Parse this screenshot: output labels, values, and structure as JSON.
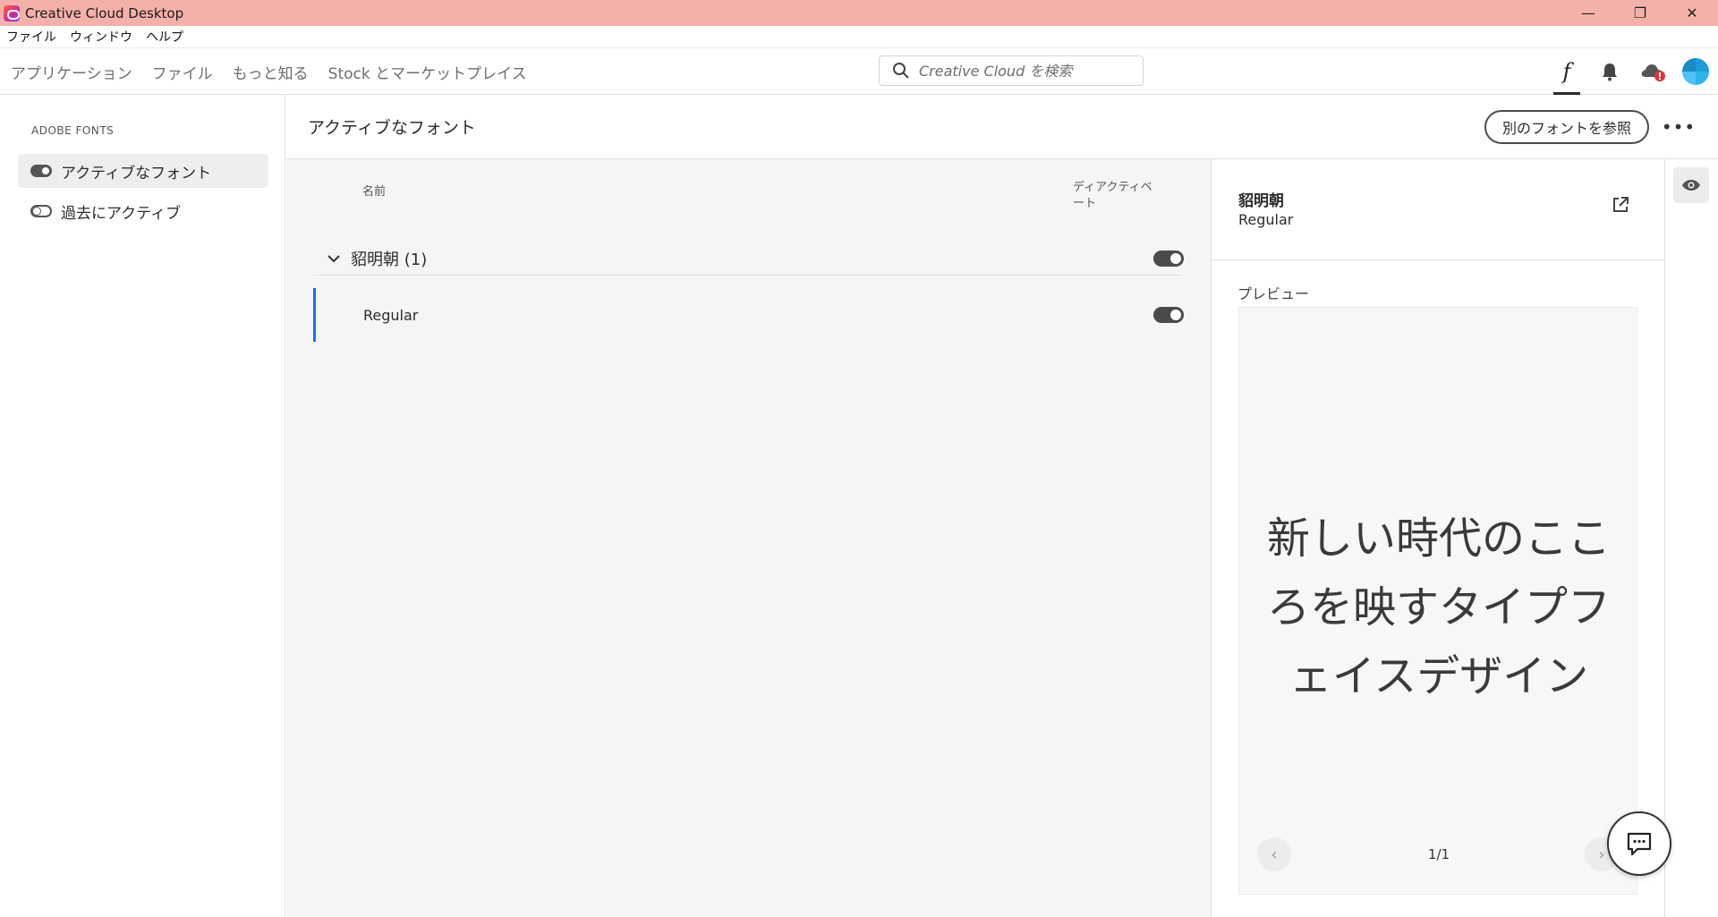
{
  "window": {
    "title": "Creative Cloud Desktop",
    "controls": {
      "minimize": "—",
      "restore": "❐",
      "close": "✕"
    }
  },
  "menubar": [
    "ファイル",
    "ウィンドウ",
    "ヘルプ"
  ],
  "topnav": {
    "links": [
      "アプリケーション",
      "ファイル",
      "もっと知る",
      "Stock とマーケットプレイス"
    ],
    "search_placeholder": "Creative Cloud を検索",
    "fonts_icon_glyph": "f"
  },
  "sidebar": {
    "section_label": "ADOBE FONTS",
    "items": [
      {
        "label": "アクティブなフォント",
        "active": true
      },
      {
        "label": "過去にアクティブ",
        "active": false
      }
    ]
  },
  "content": {
    "title": "アクティブなフォント",
    "browse_button": "別のフォントを参照",
    "more_button": "•••"
  },
  "font_list": {
    "col_name": "名前",
    "col_deactivate": "ディアクティベート",
    "family": {
      "name": "貂明朝 (1)",
      "active": true
    },
    "styles": [
      {
        "name": "Regular",
        "active": true,
        "selected": true
      }
    ]
  },
  "detail": {
    "family": "貂明朝",
    "style": "Regular",
    "preview_label": "プレビュー",
    "preview_text": "新しい時代のこころを映すタイプフェイスデザイン",
    "pager_count": "1/1",
    "pager_prev": "‹",
    "pager_next": "›"
  },
  "colors": {
    "titlebar": "#f4b1a9",
    "selection_accent": "#1473e6",
    "avatar": "#2fb3ea"
  }
}
